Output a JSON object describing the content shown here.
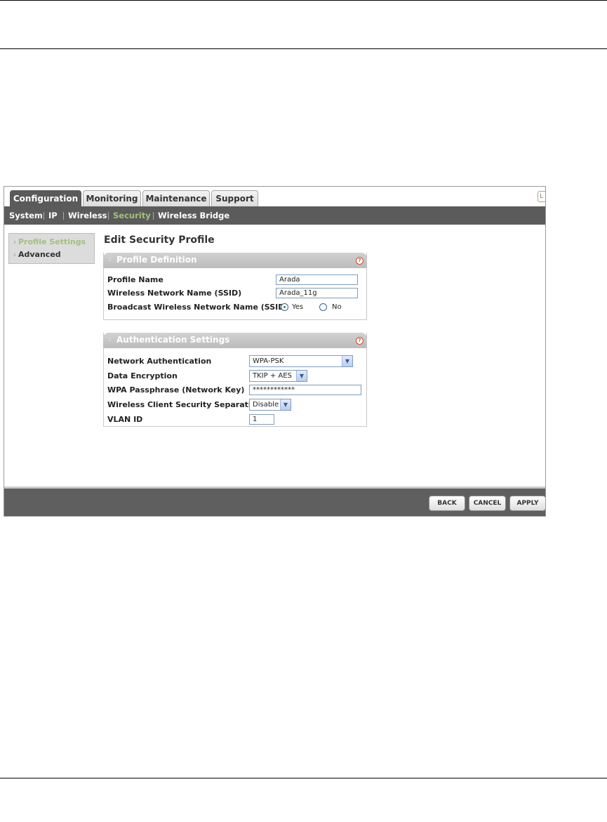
{
  "tabs": [
    {
      "label": "Configuration",
      "active": true
    },
    {
      "label": "Monitoring",
      "active": false
    },
    {
      "label": "Maintenance",
      "active": false
    },
    {
      "label": "Support",
      "active": false
    }
  ],
  "subnav": [
    {
      "label": "System",
      "active": false
    },
    {
      "label": "IP",
      "active": false
    },
    {
      "label": "Wireless",
      "active": false
    },
    {
      "label": "Security",
      "active": true
    },
    {
      "label": "Wireless Bridge",
      "active": false
    }
  ],
  "sidebar": [
    {
      "label": "Profile Settings",
      "active": true
    },
    {
      "label": "Advanced",
      "active": false
    }
  ],
  "page_title": "Edit Security Profile",
  "profile_definition": {
    "title": "Profile Definition",
    "profile_name_label": "Profile Name",
    "profile_name_value": "Arada",
    "ssid_label": "Wireless Network Name (SSID)",
    "ssid_value": "Arada_11g",
    "broadcast_label": "Broadcast Wireless Network Name (SSID)",
    "broadcast_yes": "Yes",
    "broadcast_no": "No",
    "broadcast_selected": "Yes"
  },
  "authentication": {
    "title": "Authentication Settings",
    "network_auth_label": "Network Authentication",
    "network_auth_value": "WPA-PSK",
    "data_encryption_label": "Data Encryption",
    "data_encryption_value": "TKIP + AES",
    "passphrase_label": "WPA Passphrase (Network Key)",
    "passphrase_value": "************",
    "separation_label": "Wireless Client Security Separation",
    "separation_value": "Disable",
    "vlan_label": "VLAN ID",
    "vlan_value": "1"
  },
  "buttons": {
    "back": "BACK",
    "cancel": "CANCEL",
    "apply": "APPLY"
  },
  "colors": {
    "nav_bg": "#5b5b5b",
    "active_link": "#a3c17a",
    "help_icon": "#d64b1a"
  }
}
